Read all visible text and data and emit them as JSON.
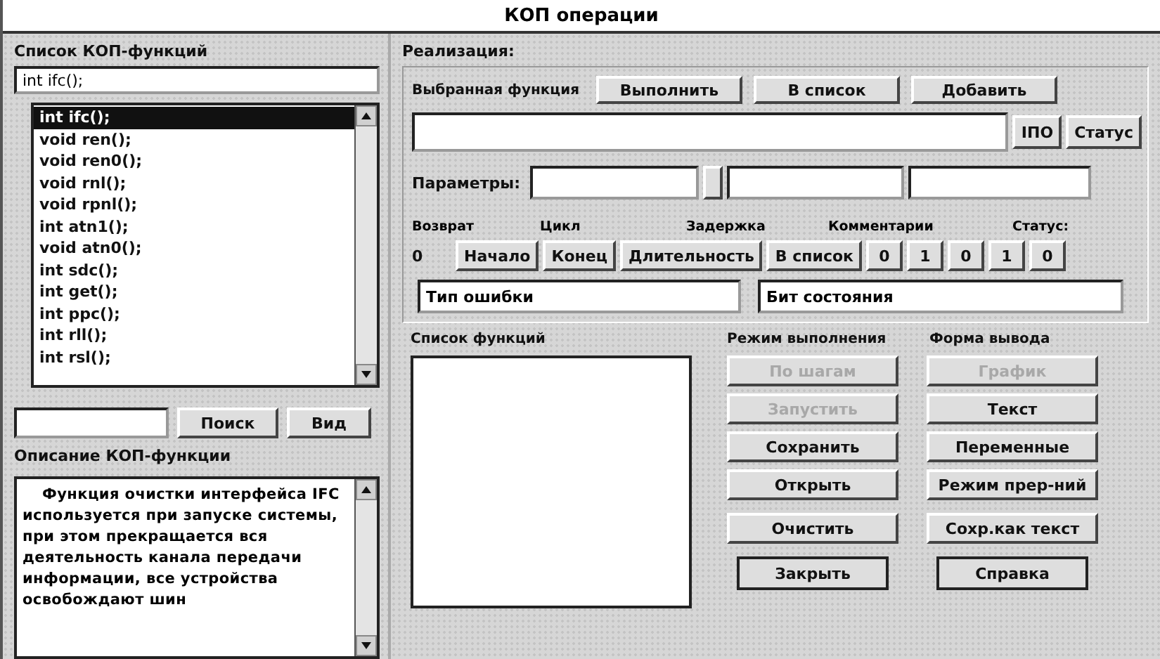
{
  "window": {
    "title": "КОП операции"
  },
  "functions_panel": {
    "heading": "Список КОП-функций",
    "current": "int ifc();",
    "items": [
      {
        "label": "int ifc();",
        "selected": true
      },
      {
        "label": "void ren();",
        "selected": false
      },
      {
        "label": "void ren0();",
        "selected": false
      },
      {
        "label": "void rnl();",
        "selected": false
      },
      {
        "label": "void rpnl();",
        "selected": false
      },
      {
        "label": "int atn1();",
        "selected": false
      },
      {
        "label": "void atn0();",
        "selected": false
      },
      {
        "label": "int sdc();",
        "selected": false
      },
      {
        "label": "int get();",
        "selected": false
      },
      {
        "label": "int ppc();",
        "selected": false
      },
      {
        "label": "int rll();",
        "selected": false
      },
      {
        "label": "int rsl();",
        "selected": false
      }
    ],
    "search_buttons": [
      "Поиск",
      "Вид"
    ],
    "description_heading": "Описание КОП-функции",
    "description": "Функция очистки интерфейса IFC используется при запуске системы, при этом прекращается вся деятельность канала передачи информации, все устройства освобождают шин"
  },
  "implementation": {
    "heading": "Реализация:",
    "selected_function_label": "Выбранная функция",
    "top_buttons": [
      "Выполнить",
      "В список",
      "Добавить"
    ],
    "side_buttons": [
      "IПО",
      "Статус"
    ],
    "parameters_label": "Параметры:",
    "columns": [
      "Возврат",
      "Цикл",
      "Задержка",
      "Комментарии",
      "Статус:"
    ],
    "return_value": "0",
    "row_buttons": [
      "Начало",
      "Конец",
      "Длительность",
      "В список"
    ],
    "status_bits": [
      "0",
      "1",
      "0",
      "1",
      "0"
    ],
    "error_type": "Тип ошибки",
    "status_bit": "Бит состояния",
    "list_heading": "Список функций",
    "mode_heading": "Режим выполнения",
    "output_heading": "Форма вывода",
    "mode_buttons": [
      {
        "label": "По шагам",
        "disabled": true
      },
      {
        "label": "Запустить",
        "disabled": true
      },
      {
        "label": "Сохранить",
        "disabled": false
      },
      {
        "label": "Открыть",
        "disabled": false
      },
      {
        "label": "Очистить",
        "disabled": false
      }
    ],
    "output_buttons": [
      {
        "label": "График",
        "disabled": true
      },
      {
        "label": "Текст",
        "disabled": false
      },
      {
        "label": "Переменные",
        "disabled": false
      },
      {
        "label": "Режим прер-ний",
        "disabled": false
      },
      {
        "label": "Сохр.как текст",
        "disabled": false
      }
    ],
    "bottom_buttons": [
      "Закрыть",
      "Справка"
    ]
  }
}
